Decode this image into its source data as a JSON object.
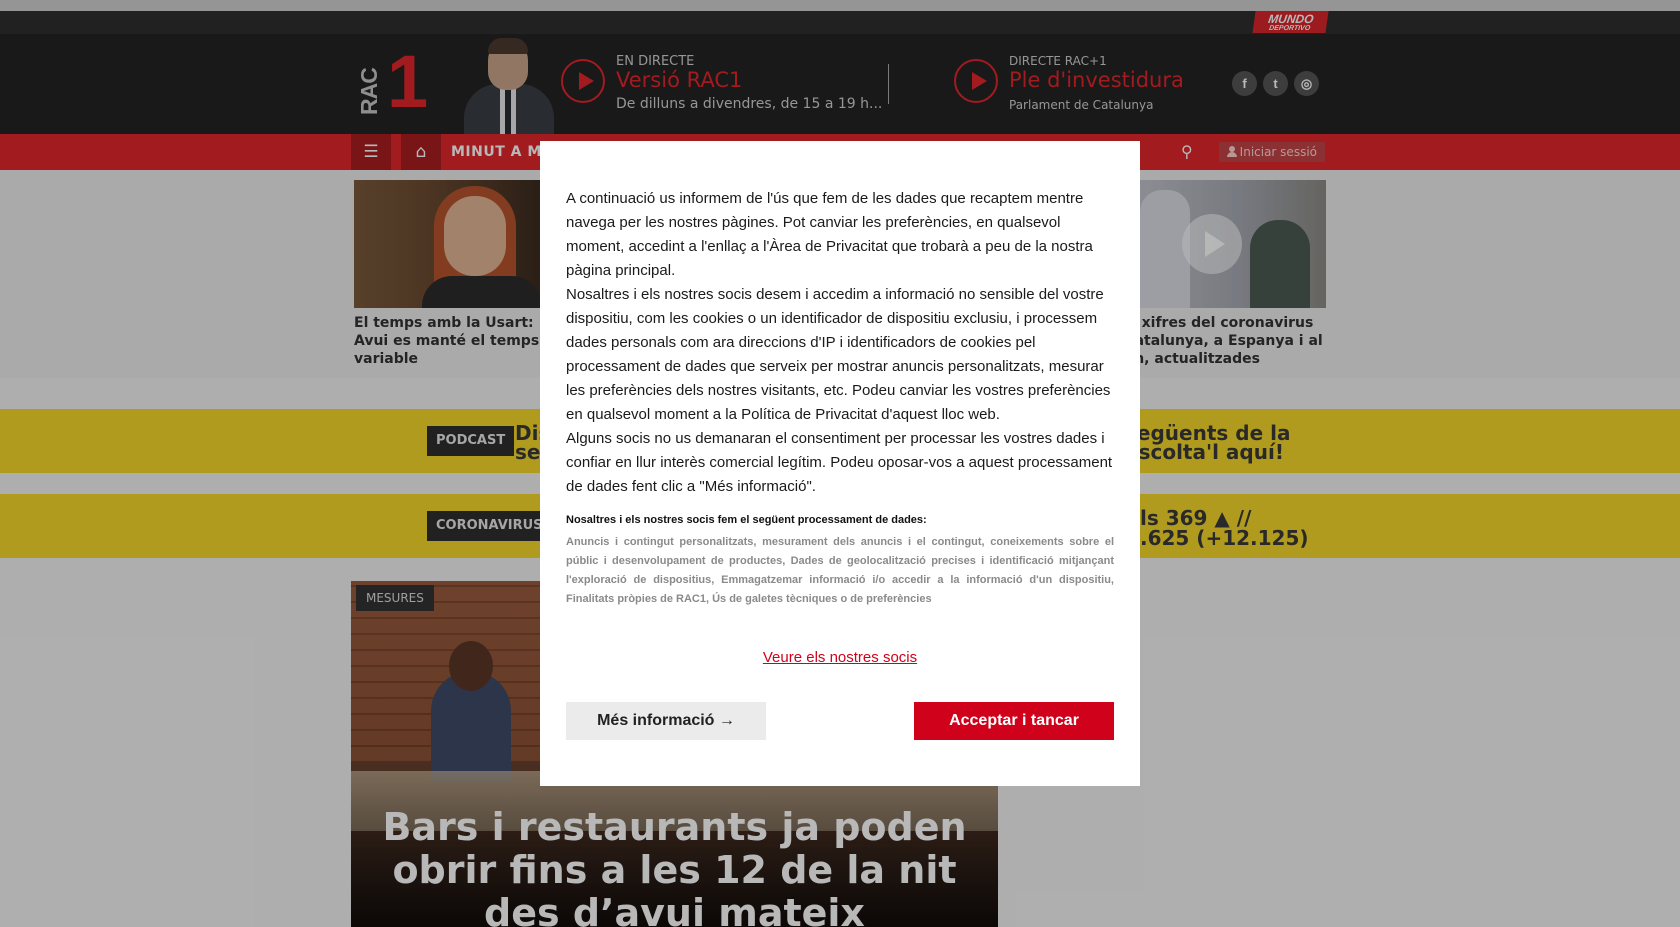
{
  "topbar": {
    "brand_line1": "MUNDO",
    "brand_line2": "DEPORTIVO"
  },
  "header": {
    "logo_rac": "RAC",
    "logo_one": "1",
    "live1": {
      "label": "EN DIRECTE",
      "program": "Versió RAC1",
      "schedule": "De dilluns a divendres, de 15 a 19 h..."
    },
    "live2": {
      "label": "DIRECTE RAC+1",
      "program": "Ple d'investidura",
      "schedule": "Parlament de Catalunya"
    },
    "social": {
      "facebook": "f",
      "twitter": "t",
      "instagram": "◎"
    }
  },
  "nav": {
    "menu_icon": "☰",
    "home_icon": "⌂",
    "section": "MINUT A MINUT",
    "search_icon": "⚲",
    "login": "Iniciar sessió"
  },
  "teasers": {
    "left_caption": "El temps amb la Usart: Avui es manté el temps variable",
    "right_caption": "Les xifres del coronavirus a Catalunya, a Espanya i al món, actualitzades"
  },
  "banners": {
    "podcast_tag": "PODCAST",
    "podcast_text_left": "Dis",
    "podcast_text_left2": "sex",
    "podcast_text_right": "següents de la",
    "podcast_text_right2": "escolta'l aquí!",
    "corona_tag": "CORONAVIRUS",
    "corona_text_right": "ls 369 ▲ //",
    "corona_text_right2": ".625 (+12.125)"
  },
  "article": {
    "category": "MESURES",
    "title": "Bars i restaurants ja poden obrir fins a les 12 de la nit des d’avui mateix"
  },
  "consent": {
    "paragraph1": "A continuació us informem de l'ús que fem de les dades que recaptem mentre navega per les nostres pàgines. Pot canviar les preferències, en qualsevol moment, accedint a l'enllaç a l'Àrea de Privacitat que trobarà a peu de la nostra pàgina principal.",
    "paragraph2": "Nosaltres i els nostres socis desem i accedim a informació no sensible del vostre dispositiu, com les cookies o un identificador de dispositiu exclusiu, i processem dades personals com ara direccions d'IP i identificadors de cookies pel processament de dades que serveix per mostrar anuncis personalitzats, mesurar les preferències dels nostres visitants, etc. Podeu canviar les vostres preferències en qualsevol moment a la Política de Privacitat d'aquest lloc web.",
    "paragraph3": "Alguns socis no us demanaran el consentiment per processar les vostres dades i confiar en llur interès comercial legítim. Podeu oposar-vos a aquest processament de dades fent clic a \"Més informació\".",
    "purposes_title": "Nosaltres i els nostres socis fem el següent processament de dades:",
    "purposes": "Anuncis i contingut personalitzats, mesurament dels anuncis i el contingut, coneixements sobre el públic i desenvolupament de productes, Dades de geolocalització precises i identificació mitjançant l'exploració de dispositius, Emmagatzemar informació i/o accedir a la informació d'un dispositiu, Finalitats pròpies de RAC1, Ús de galetes tècniques o de preferències",
    "partners_link": "Veure els nostres socis",
    "more_info_button": "Més informació →",
    "accept_button": "Acceptar i tancar"
  },
  "colors": {
    "brand_red": "#e0262c",
    "consent_red": "#d0021b",
    "banner_yellow": "#f4d72a"
  }
}
